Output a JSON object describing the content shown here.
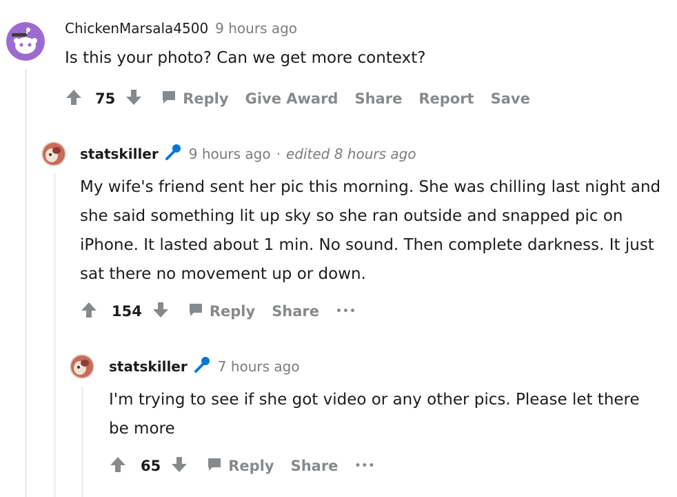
{
  "comments": [
    {
      "username": "ChickenMarsala4500",
      "time": "9 hours ago",
      "body": "Is this your photo? Can we get more context?",
      "votes": "75",
      "actions": {
        "reply": "Reply",
        "give_award": "Give Award",
        "share": "Share",
        "report": "Report",
        "save": "Save"
      }
    },
    {
      "username": "statskiller",
      "time": "9 hours ago",
      "separator": "·",
      "edited": "edited 8 hours ago",
      "body": "My wife's friend sent her pic this morning. She was chilling last night and she said something lit up sky so she ran outside and snapped pic on iPhone. It lasted about 1 min. No sound. Then complete darkness. It just sat there no movement up or down.",
      "votes": "154",
      "actions": {
        "reply": "Reply",
        "share": "Share",
        "more": "•••"
      }
    },
    {
      "username": "statskiller",
      "time": "7 hours ago",
      "body": "I'm trying to see if she got video or any other pics. Please let there be more",
      "votes": "65",
      "actions": {
        "reply": "Reply",
        "share": "Share",
        "more": "•••"
      }
    }
  ],
  "colors": {
    "accent_avatar": "#9d6bd0",
    "mic_blue": "#0079d3",
    "meta_gray": "#7c7c7c",
    "action_gray": "#878a8c",
    "thread_line": "#edeff1"
  }
}
